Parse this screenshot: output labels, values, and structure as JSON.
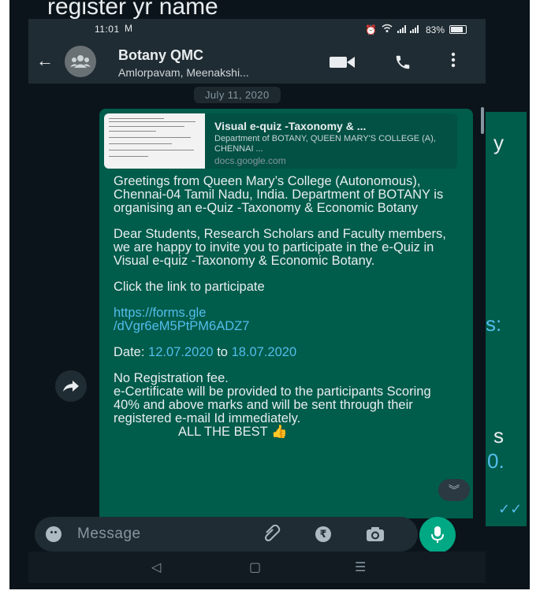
{
  "background": {
    "top_text": "register yr name",
    "right_fragments": [
      "y",
      "s:",
      "s",
      "0."
    ]
  },
  "status_bar": {
    "time": "11:01",
    "gmail_indicator": "M",
    "battery": "83%"
  },
  "header": {
    "back_icon": "arrow-left-icon",
    "title": "Botany QMC",
    "subtitle": "Amlorpavam, Meenakshi..."
  },
  "date_chip": "July 11, 2020",
  "message": {
    "preview": {
      "title": "Visual e-quiz -Taxonomy & ...",
      "description": "Department of BOTANY, QUEEN MARY'S COLLEGE (A), CHENNAI ...",
      "domain": "docs.google.com"
    },
    "greeting": "Greetings from Queen Mary’s College (Autonomous), Chennai-04  Tamil Nadu, India. Department of BOTANY is organising an e-Quiz -Taxonomy & Economic Botany",
    "invite": "Dear Students, Research Scholars and Faculty members, we are happy to invite you to participate in the e-Quiz in Visual e-quiz   -Taxonomy & Economic Botany.",
    "click_line": "Click the link to participate",
    "link_line1": "https://forms.gle",
    "link_line2": "/dVgr6eM5PtPM6ADZ7",
    "date_prefix": "Date: ",
    "date_from": "12.07.2020",
    "date_to_word": " to ",
    "date_to": "18.07.2020",
    "notes": "No Registration fee.",
    "certificate": "e-Certificate will be provided to the participants Scoring 40% and above marks and will be sent through their registered e-mail Id  immediately.",
    "closing": "ALL THE BEST"
  },
  "input": {
    "placeholder": "Message"
  },
  "colors": {
    "bubble": "#005c4b",
    "link": "#53bdeb",
    "mic": "#00a884"
  }
}
